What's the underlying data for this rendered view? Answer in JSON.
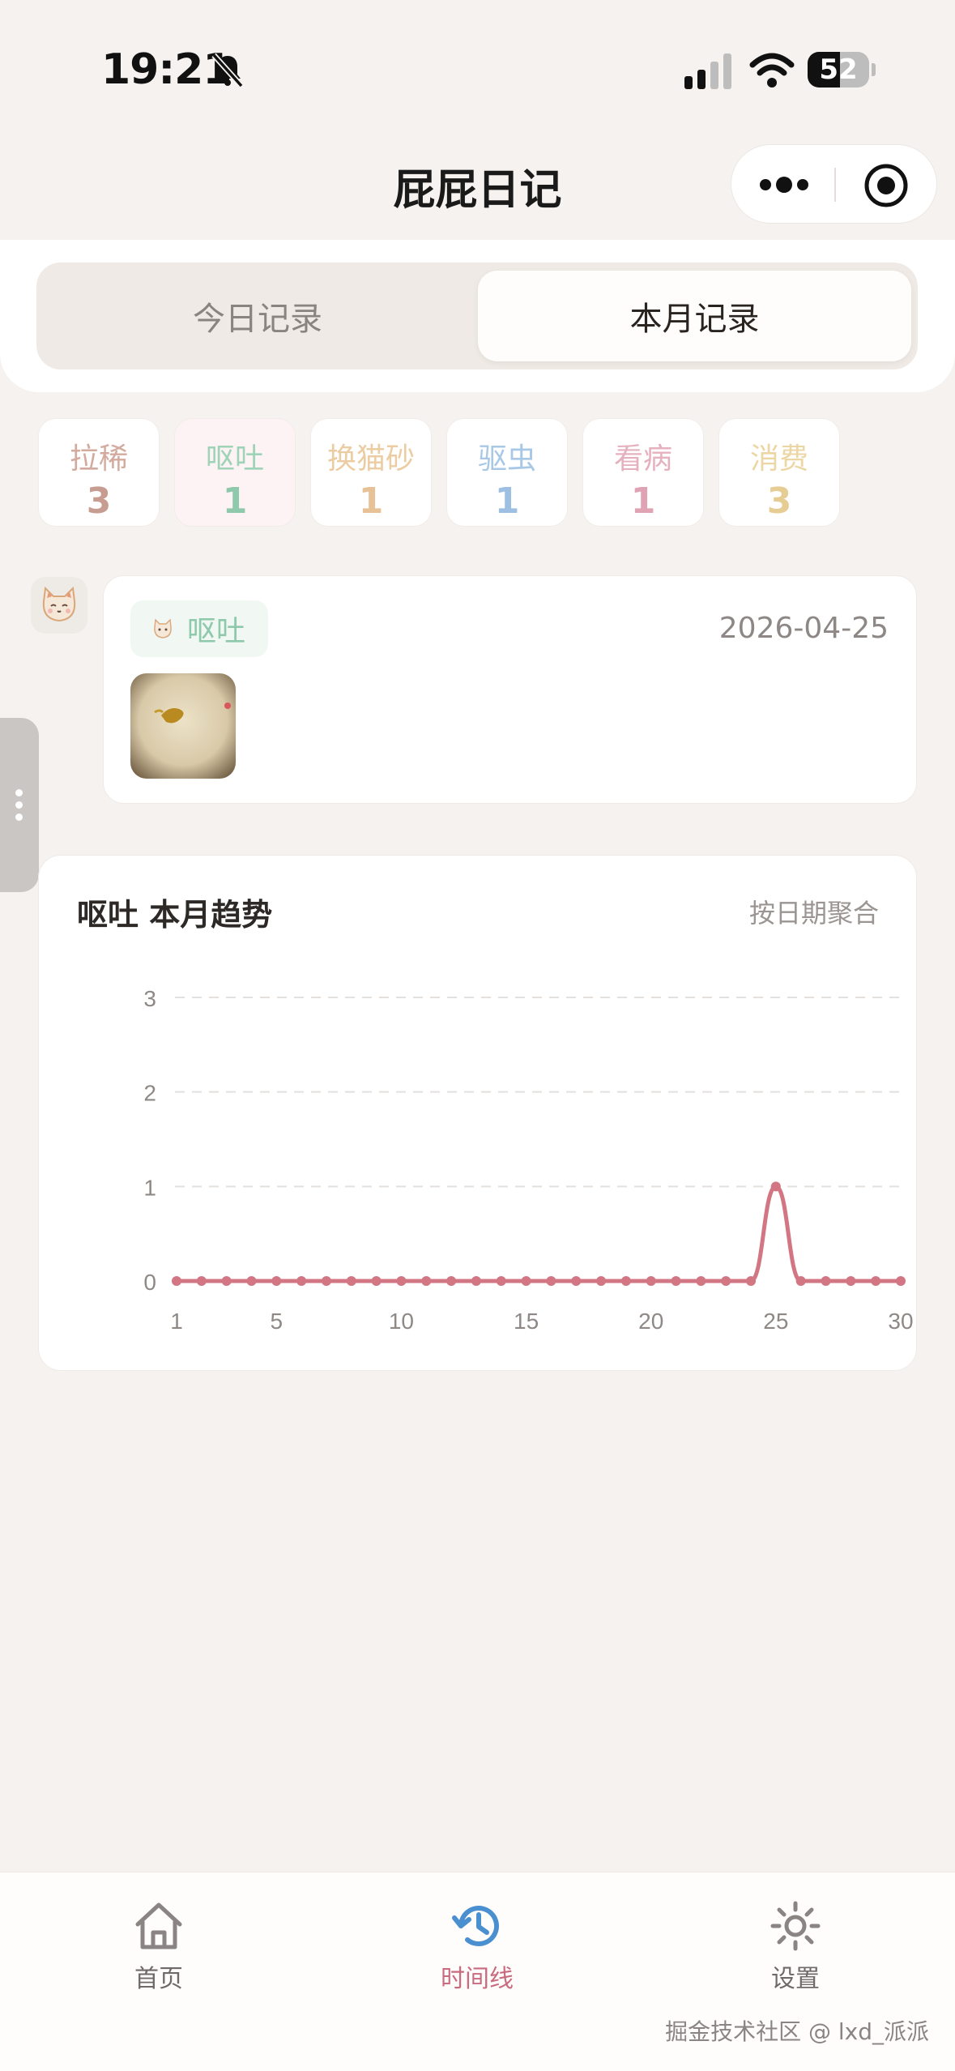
{
  "status_bar": {
    "time": "19:21",
    "battery_level": "52"
  },
  "nav": {
    "title": "屁屁日记"
  },
  "tabs": {
    "today": "今日记录",
    "month": "本月记录",
    "active": "month"
  },
  "stats": [
    {
      "label": "拉稀",
      "count": "3",
      "color": "#d3aa9e",
      "count_color": "#c79d92"
    },
    {
      "label": "呕吐",
      "count": "1",
      "color": "#9fd3b8",
      "count_color": "#8fc9ab",
      "bg": "#fdf3f4"
    },
    {
      "label": "换猫砂",
      "count": "1",
      "color": "#eccca2",
      "count_color": "#e6c296"
    },
    {
      "label": "驱虫",
      "count": "1",
      "color": "#a9c8e6",
      "count_color": "#9cbfe2"
    },
    {
      "label": "看病",
      "count": "1",
      "color": "#e6b1bf",
      "count_color": "#e0a3b3"
    },
    {
      "label": "消费",
      "count": "3",
      "color": "#ecd6a4",
      "count_color": "#e5cd94"
    }
  ],
  "record": {
    "tag": "呕吐",
    "date": "2026-04-25"
  },
  "chart_data": {
    "type": "line",
    "title": "呕吐 本月趋势",
    "subtitle": "按日期聚合",
    "x": [
      1,
      2,
      3,
      4,
      5,
      6,
      7,
      8,
      9,
      10,
      11,
      12,
      13,
      14,
      15,
      16,
      17,
      18,
      19,
      20,
      21,
      22,
      23,
      24,
      25,
      26,
      27,
      28,
      29,
      30
    ],
    "values": [
      0,
      0,
      0,
      0,
      0,
      0,
      0,
      0,
      0,
      0,
      0,
      0,
      0,
      0,
      0,
      0,
      0,
      0,
      0,
      0,
      0,
      0,
      0,
      0,
      1,
      0,
      0,
      0,
      0,
      0
    ],
    "x_ticks": [
      "1",
      "5",
      "10",
      "15",
      "20",
      "25",
      "30"
    ],
    "y_ticks": [
      "0",
      "1",
      "2",
      "3"
    ],
    "ylim": [
      0,
      3
    ],
    "xlim": [
      1,
      30
    ],
    "grid": true,
    "line_color": "#d27683"
  },
  "tab_bar": {
    "home": "首页",
    "timeline": "时间线",
    "settings": "设置",
    "active": "timeline",
    "active_color": "#c96b7e",
    "active_icon_color": "#4a8fd0"
  },
  "watermark": "掘金技术社区 @ lxd_派派"
}
